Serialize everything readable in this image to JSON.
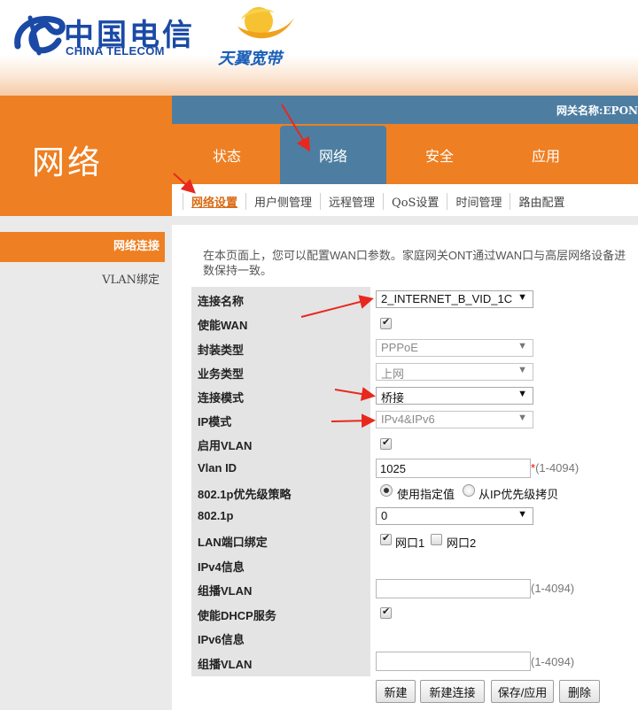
{
  "header": {
    "logo_cn": "中国电信",
    "logo_en": "CHINA TELECOM",
    "broadband_name": "天翼宽带",
    "brand_color": "#1a4aa6"
  },
  "page_heading": "网络",
  "gateway_name": "网关名称:EPON",
  "tabs": [
    {
      "label": "状态",
      "active": false
    },
    {
      "label": "网络",
      "active": true
    },
    {
      "label": "安全",
      "active": false
    },
    {
      "label": "应用",
      "active": false
    }
  ],
  "subnav": [
    {
      "label": "网络设置",
      "active": true
    },
    {
      "label": "用户侧管理",
      "active": false
    },
    {
      "label": "远程管理",
      "active": false
    },
    {
      "label": "QoS设置",
      "active": false
    },
    {
      "label": "时间管理",
      "active": false
    },
    {
      "label": "路由配置",
      "active": false
    }
  ],
  "sidebar": [
    {
      "label": "网络连接",
      "active": true
    },
    {
      "label": "VLAN绑定",
      "active": false
    }
  ],
  "description_line1": "在本页面上，您可以配置WAN口参数。家庭网关ONT通过WAN口与高层网络设备进",
  "description_line2": "数保持一致。",
  "form": {
    "connection_name": {
      "label": "连接名称",
      "value": "2_INTERNET_B_VID_1C"
    },
    "enable_wan": {
      "label": "使能WAN",
      "checked": true
    },
    "encapsulation": {
      "label": "封装类型",
      "value": "PPPoE",
      "disabled": true
    },
    "service_type": {
      "label": "业务类型",
      "value": "上网",
      "disabled": true
    },
    "connection_mode": {
      "label": "连接模式",
      "value": "桥接"
    },
    "ip_mode": {
      "label": "IP模式",
      "value": "IPv4&IPv6",
      "disabled": true
    },
    "enable_vlan": {
      "label": "启用VLAN",
      "checked": true
    },
    "vlan_id": {
      "label": "Vlan ID",
      "value": "1025",
      "hint": "(1-4094)",
      "required_mark": "*"
    },
    "priority_policy": {
      "label": "802.1p优先级策略",
      "option1": "使用指定值",
      "option2": "从IP优先级拷贝",
      "selected": 1
    },
    "priority_802_1p": {
      "label": "802.1p",
      "value": "0"
    },
    "lan_binding": {
      "label": "LAN端口绑定",
      "port1": "网口1",
      "port1_checked": true,
      "port2": "网口2",
      "port2_checked": false
    },
    "ipv4_info": {
      "label": "IPv4信息"
    },
    "multicast_vlan_v4": {
      "label": "组播VLAN",
      "value": "",
      "hint": "(1-4094)"
    },
    "enable_dhcp": {
      "label": "使能DHCP服务",
      "checked": true
    },
    "ipv6_info": {
      "label": "IPv6信息"
    },
    "multicast_vlan_v6": {
      "label": "组播VLAN",
      "value": "",
      "hint": "(1-4094)"
    }
  },
  "buttons": {
    "new": "新建",
    "new_connection": "新建连接",
    "save_apply": "保存/应用",
    "delete": "删除"
  },
  "dropdown_arrow": "▼",
  "colors": {
    "orange": "#ee7f22",
    "steel_blue": "#4d7ea2",
    "annotation_red": "#e8281e"
  }
}
